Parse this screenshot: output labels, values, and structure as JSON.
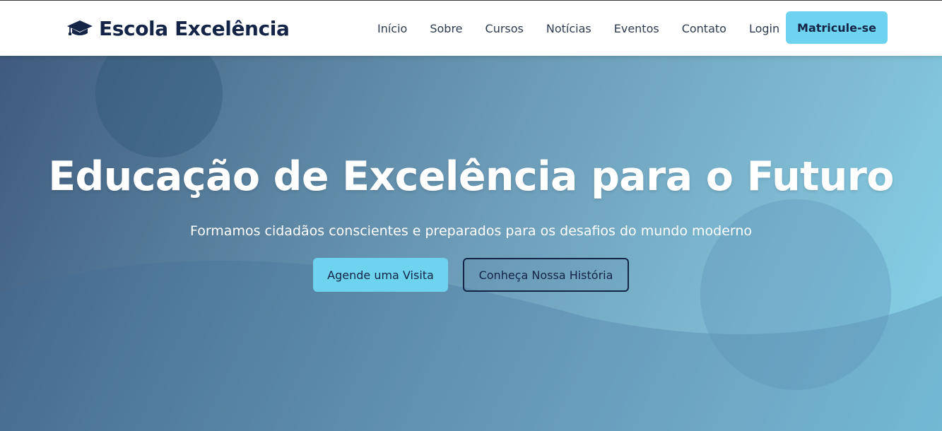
{
  "brand": {
    "name": "Escola Excelência",
    "logo_icon": "graduation-cap-icon"
  },
  "nav": {
    "items": [
      {
        "label": "Início"
      },
      {
        "label": "Sobre"
      },
      {
        "label": "Cursos"
      },
      {
        "label": "Notícias"
      },
      {
        "label": "Eventos"
      },
      {
        "label": "Contato"
      },
      {
        "label": "Login"
      }
    ],
    "cta_label": "Matricule-se"
  },
  "hero": {
    "title": "Educação de Excelência para o Futuro",
    "subtitle": "Formamos cidadãos conscientes e preparados para os desafios do mundo moderno",
    "primary_button": "Agende uma Visita",
    "secondary_button": "Conheça Nossa História"
  },
  "colors": {
    "brand_dark": "#142447",
    "accent": "#6dd3ee",
    "hero_gradient_start": "#3f5a7e",
    "hero_gradient_end": "#86d4ea"
  }
}
